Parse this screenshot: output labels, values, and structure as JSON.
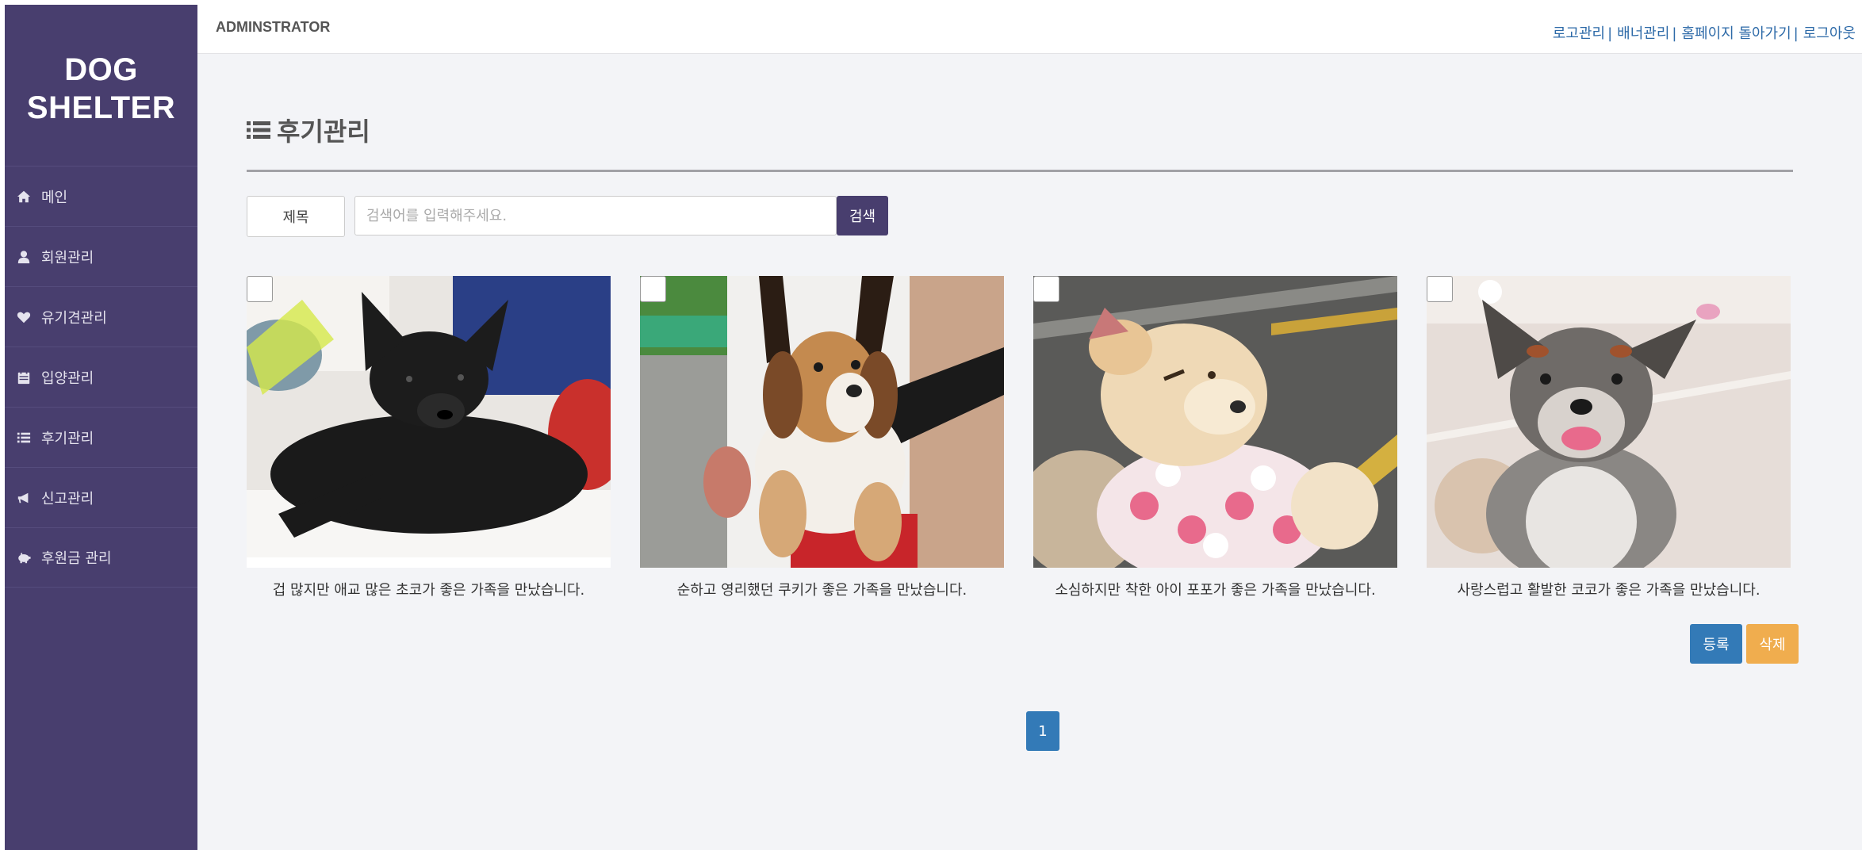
{
  "sidebar": {
    "logo_line1": "DOG",
    "logo_line2": "SHELTER",
    "items": [
      {
        "label": "메인",
        "icon": "home-icon"
      },
      {
        "label": "회원관리",
        "icon": "user-icon"
      },
      {
        "label": "유기견관리",
        "icon": "heart-icon"
      },
      {
        "label": "입양관리",
        "icon": "calendar-icon"
      },
      {
        "label": "후기관리",
        "icon": "list-icon"
      },
      {
        "label": "신고관리",
        "icon": "bullhorn-icon"
      },
      {
        "label": "후원금 관리",
        "icon": "piggy-bank-icon"
      }
    ],
    "color": "#483e6e"
  },
  "topbar": {
    "admin_label": "ADMINSTRATOR",
    "links": [
      "로고관리",
      "배너관리",
      "홈페이지 돌아가기",
      "로그아웃"
    ],
    "separator": "|"
  },
  "main": {
    "title": "후기관리",
    "title_icon": "list-icon",
    "search": {
      "type_label": "제목",
      "placeholder": "검색어를 입력해주세요.",
      "value": "",
      "button_label": "검색"
    },
    "cards": [
      {
        "caption": "겁 많지만 애교 많은 초코가 좋은 가족을 만났습니다.",
        "image": "black-dog-photo"
      },
      {
        "caption": "순하고 영리했던 쿠키가 좋은 가족을 만났습니다.",
        "image": "beagle-puppy-photo"
      },
      {
        "caption": "소심하지만 착한 아이 포포가 좋은 가족을 만났습니다.",
        "image": "fluffy-puppy-photo"
      },
      {
        "caption": "사랑스럽고 활발한 코코가 좋은 가족을 만났습니다.",
        "image": "gray-dog-photo"
      }
    ],
    "register_label": "등록",
    "delete_label": "삭제",
    "pagination": {
      "current": "1"
    }
  },
  "colors": {
    "sidebar": "#483e6e",
    "primary": "#337ab7",
    "warning": "#f0ad4e",
    "link": "#2d6aa8",
    "background": "#f3f4f7"
  }
}
